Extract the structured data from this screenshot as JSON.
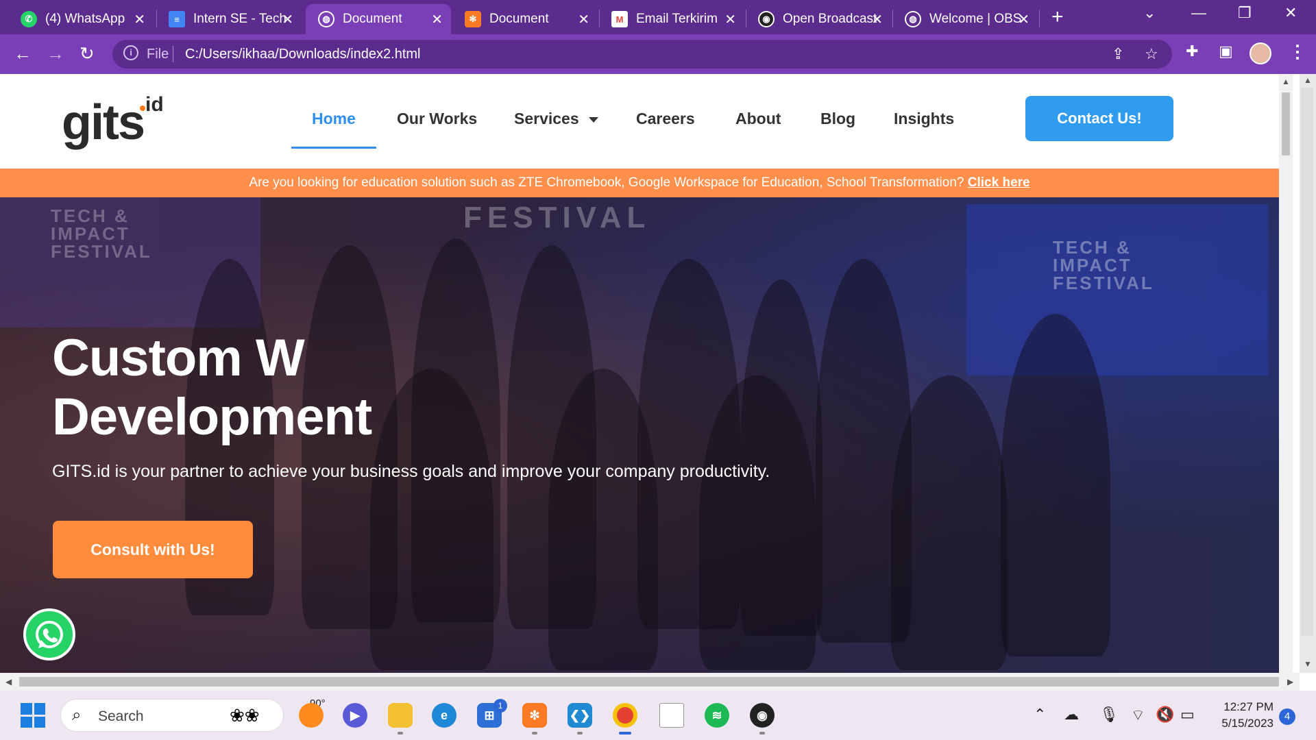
{
  "browser": {
    "tabs": [
      {
        "title": "(4) WhatsApp",
        "favicon": "whatsapp-icon",
        "color": "#25d366"
      },
      {
        "title": "Intern SE - Tech",
        "favicon": "docs-icon",
        "color": "#4285f4"
      },
      {
        "title": "Document",
        "favicon": "globe-icon",
        "color": "#ffffff",
        "active": true
      },
      {
        "title": "Document",
        "favicon": "xampp-icon",
        "color": "#fb7a24"
      },
      {
        "title": "Email Terkirim",
        "favicon": "gmail-icon",
        "color": "#ea4335"
      },
      {
        "title": "Open Broadcast",
        "favicon": "obs-icon",
        "color": "#222222"
      },
      {
        "title": "Welcome | OBS",
        "favicon": "globe-icon",
        "color": "#ffffff"
      }
    ],
    "address": {
      "scheme_label": "File",
      "url": "C:/Users/ikhaa/Downloads/index2.html"
    }
  },
  "site": {
    "logo_main": "gits",
    "logo_sup": "id",
    "nav": {
      "home": "Home",
      "works": "Our Works",
      "services": "Services",
      "careers": "Careers",
      "about": "About",
      "blog": "Blog",
      "insights": "Insights"
    },
    "contact_button": "Contact Us!",
    "promo_text": "Are you looking for education solution such as ZTE Chromebook, Google Workspace for Education, School Transformation?",
    "promo_link": "Click here",
    "hero": {
      "title_line1": "Custom W",
      "title_line2": "Development",
      "subtitle": "GITS.id is your partner to achieve your business goals and improve your company productivity.",
      "button": "Consult with Us!",
      "banner_left": "TECH &\nIMPACT\nFESTIVAL",
      "banner_center": "FESTIVAL",
      "banner_right": "TECH &\nIMPACT\nFESTIVAL"
    }
  },
  "taskbar": {
    "search_placeholder": "Search",
    "weather_temp": "90°",
    "store_badge": "1",
    "time": "12:27 PM",
    "date": "5/15/2023",
    "notification_count": "4"
  },
  "colors": {
    "browser_frame": "#5b2c8d",
    "browser_toolbar": "#7a3fb6",
    "primary_blue": "#2f9cf0",
    "accent_orange": "#ff8b3d",
    "promo_bar": "#ff8f4a"
  }
}
